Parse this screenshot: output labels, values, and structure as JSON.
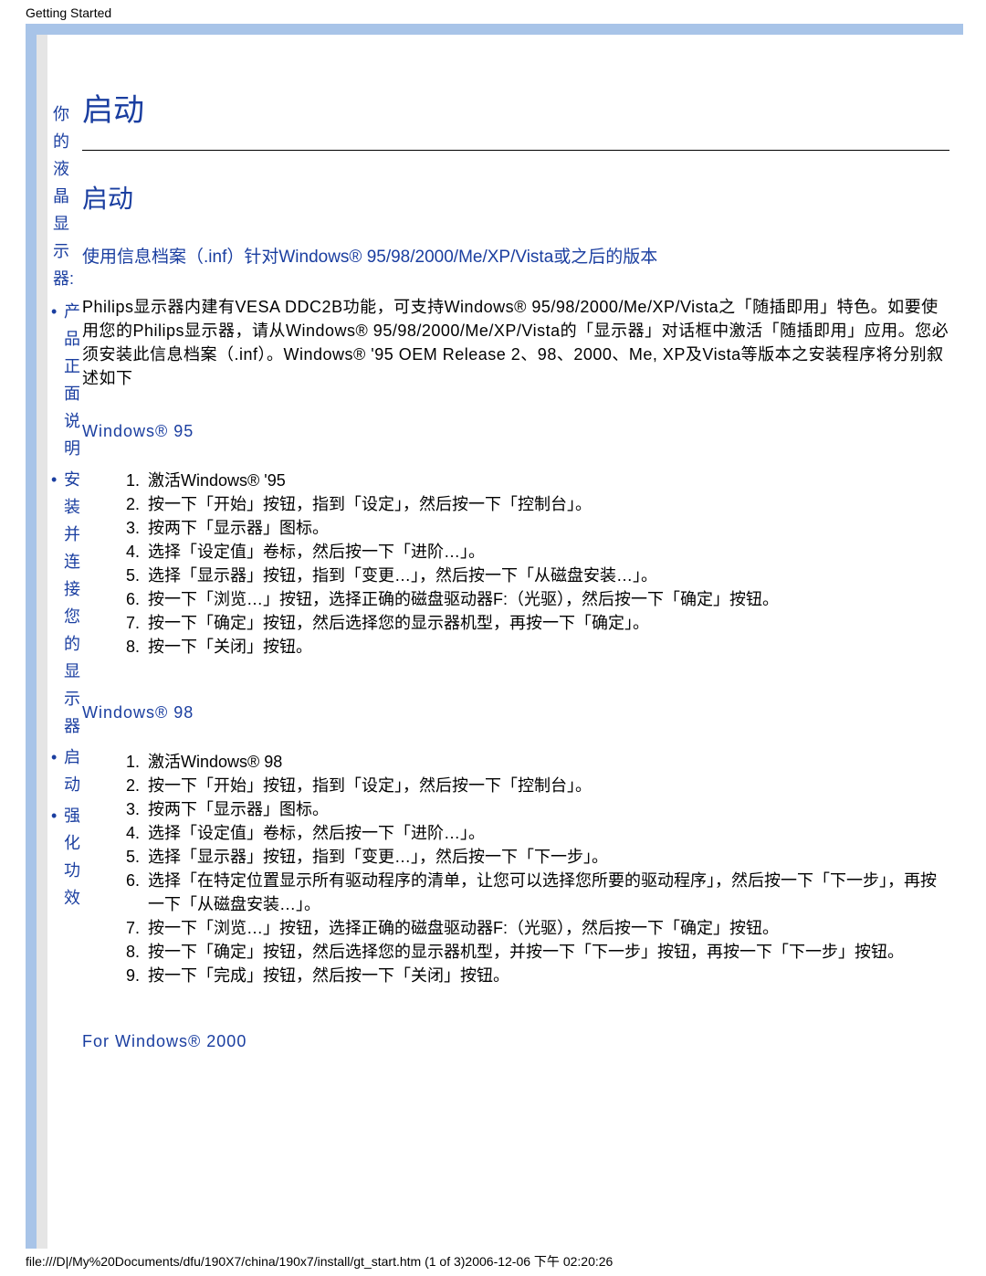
{
  "header": "Getting Started",
  "sidebar": {
    "title": "你的液晶显示器:",
    "items": [
      "产品正面说明",
      "安装并连接您的显示器",
      "启动",
      "强化功效"
    ]
  },
  "content": {
    "main_title": "启动",
    "sub_title": "启动",
    "inf_line": "使用信息档案（.inf）针对Windows® 95/98/2000/Me/XP/Vista或之后的版本",
    "intro_para": "Philips显示器内建有VESA DDC2B功能，可支持Windows® 95/98/2000/Me/XP/Vista之「随插即用」特色。如要使用您的Philips显示器，请从Windows® 95/98/2000/Me/XP/Vista的「显示器」对话框中激活「随插即用」应用。您必须安装此信息档案（.inf）。Windows® '95 OEM Release 2、98、2000、Me, XP及Vista等版本之安装程序将分别叙述如下",
    "win95_label": "Windows® 95",
    "win95_steps": [
      "激活Windows® '95",
      "按一下「开始」按钮，指到「设定」，然后按一下「控制台」。",
      "按两下「显示器」图标。",
      "选择「设定值」卷标，然后按一下「进阶…」。",
      "选择「显示器」按钮，指到「变更…」，然后按一下「从磁盘安装…」。",
      "按一下「浏览…」按钮，选择正确的磁盘驱动器F:（光驱），然后按一下「确定」按钮。",
      "按一下「确定」按钮，然后选择您的显示器机型，再按一下「确定」。",
      "按一下「关闭」按钮。"
    ],
    "win98_label": "Windows® 98",
    "win98_steps": [
      "激活Windows® 98",
      "按一下「开始」按钮，指到「设定」，然后按一下「控制台」。",
      "按两下「显示器」图标。",
      "选择「设定值」卷标，然后按一下「进阶…」。",
      "选择「显示器」按钮，指到「变更…」，然后按一下「下一步」。",
      "选择「在特定位置显示所有驱动程序的清单，让您可以选择您所要的驱动程序」，然后按一下「下一步」，再按一下「从磁盘安装…」。",
      "按一下「浏览…」按钮，选择正确的磁盘驱动器F:（光驱），然后按一下「确定」按钮。",
      "按一下「确定」按钮，然后选择您的显示器机型，并按一下「下一步」按钮，再按一下「下一步」按钮。",
      "按一下「完成」按钮，然后按一下「关闭」按钮。"
    ],
    "win2000_label": "For Windows® 2000"
  },
  "footer": "file:///D|/My%20Documents/dfu/190X7/china/190x7/install/gt_start.htm (1 of 3)2006-12-06 下午 02:20:26"
}
